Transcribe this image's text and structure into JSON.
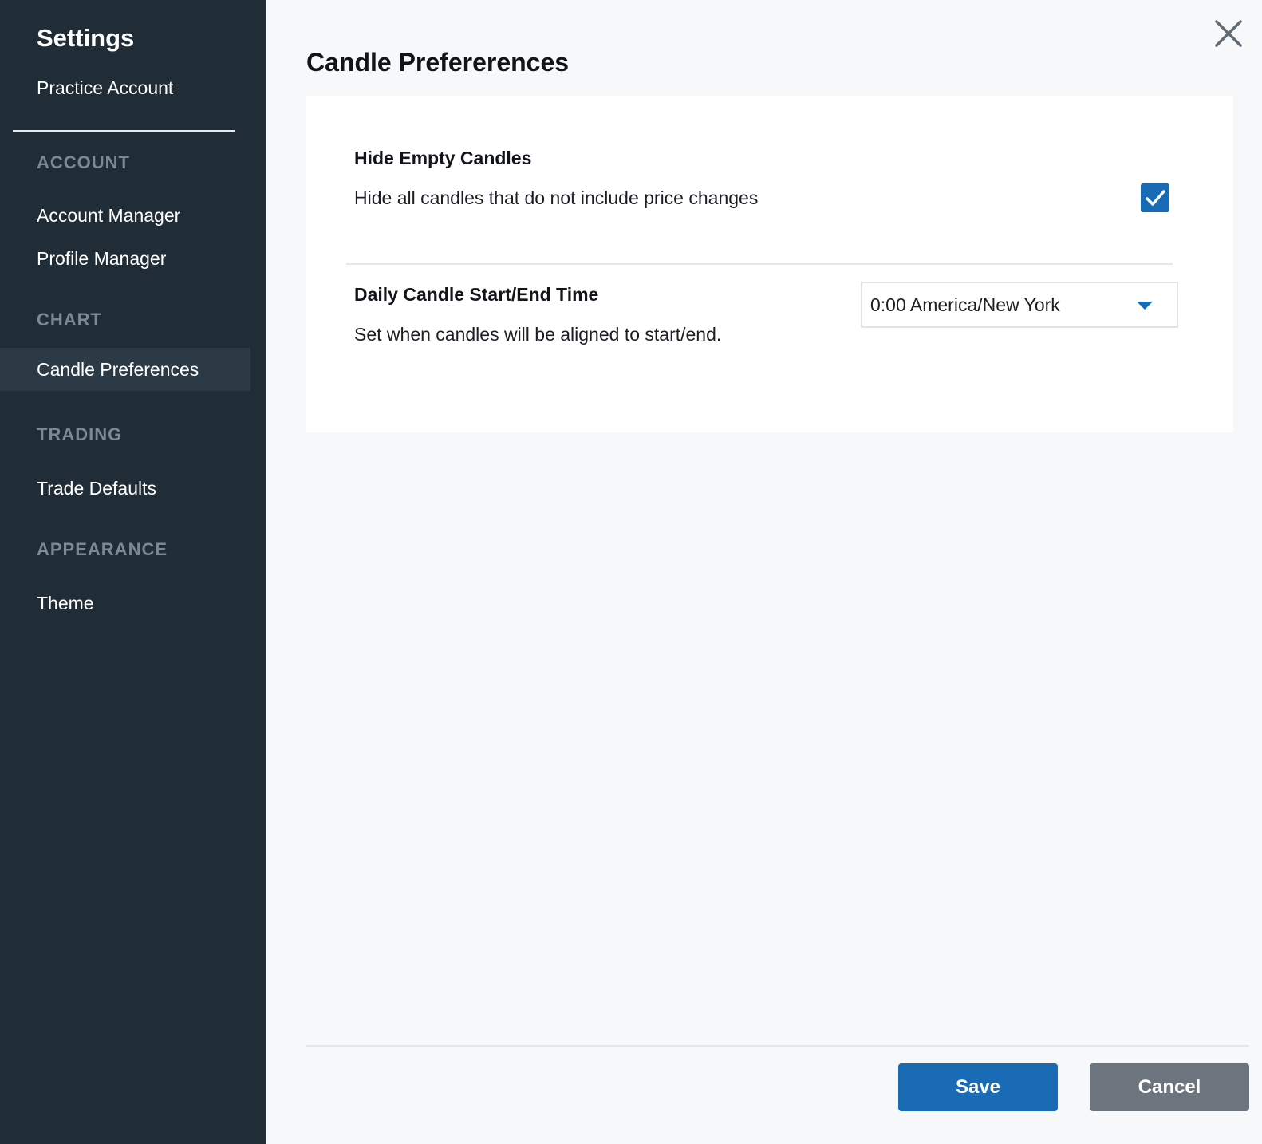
{
  "sidebar": {
    "title": "Settings",
    "account_type": "Practice Account",
    "sections": [
      {
        "label": "ACCOUNT",
        "items": [
          {
            "label": "Account Manager",
            "active": false
          },
          {
            "label": "Profile Manager",
            "active": false
          }
        ]
      },
      {
        "label": "CHART",
        "items": [
          {
            "label": "Candle Preferences",
            "active": true
          }
        ]
      },
      {
        "label": "TRADING",
        "items": [
          {
            "label": "Trade Defaults",
            "active": false
          }
        ]
      },
      {
        "label": "APPEARANCE",
        "items": [
          {
            "label": "Theme",
            "active": false
          }
        ]
      }
    ]
  },
  "main": {
    "title": "Candle Prefererences",
    "settings": [
      {
        "title": "Hide Empty Candles",
        "description": "Hide all candles that do not include price changes",
        "control": "checkbox",
        "checked": true
      },
      {
        "title": "Daily Candle Start/End Time",
        "description": "Set when candles will be aligned to start/end.",
        "control": "select",
        "selected_value": "0:00 America/New York"
      }
    ],
    "icons": {
      "close": "close-icon",
      "check": "check-icon",
      "caret": "caret-down-icon"
    }
  },
  "footer": {
    "save_label": "Save",
    "cancel_label": "Cancel"
  },
  "colors": {
    "sidebar_bg": "#202d37",
    "sidebar_active": "#2c3a45",
    "accent": "#1a6bb5",
    "cancel": "#6c757d",
    "section_label": "#7c8892"
  }
}
